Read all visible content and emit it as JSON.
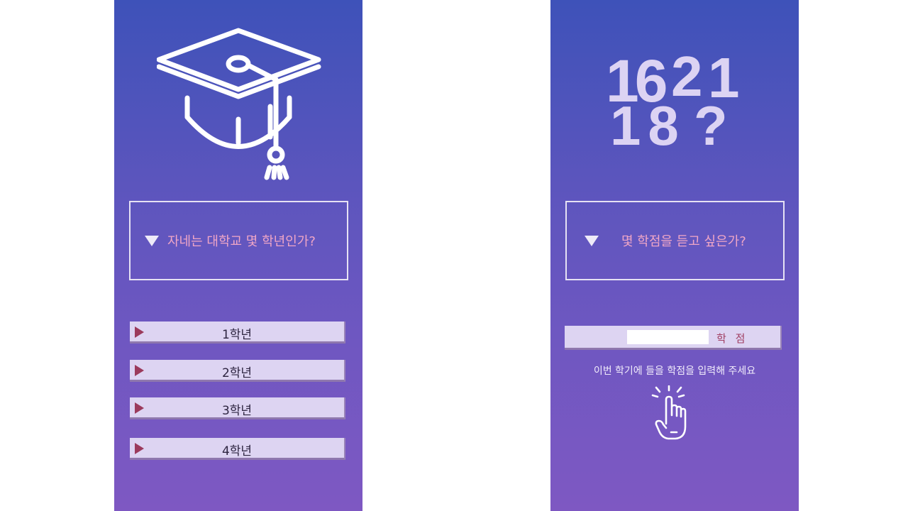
{
  "left_screen": {
    "question": "자네는 대학교 몇 학년인가?",
    "grades": [
      "1학년",
      "2학년",
      "3학년",
      "4학년"
    ],
    "icons": {
      "hero": "graduation-cap-icon",
      "question": "triangle-down-icon",
      "grade": "triangle-right-icon"
    }
  },
  "right_screen": {
    "numbers": {
      "n1": "16",
      "n2": "2",
      "n3": "1",
      "n4": "18",
      "n5": "?"
    },
    "question": "몇 학점을 듣고 싶은가?",
    "credit_input_value": "",
    "credit_unit": "학 점",
    "hint": "이번 학기에 들을 학점을 입력해 주세요",
    "icons": {
      "question": "triangle-down-icon",
      "hint": "tap-finger-icon"
    }
  },
  "colors": {
    "panel_top": "#3e52b9",
    "panel_bottom": "#7e58c2",
    "question_text": "#f0a6c6",
    "button_bg": "#ddd4f2",
    "button_arrow": "#9b3a5c",
    "unit_text": "#a03e62"
  }
}
